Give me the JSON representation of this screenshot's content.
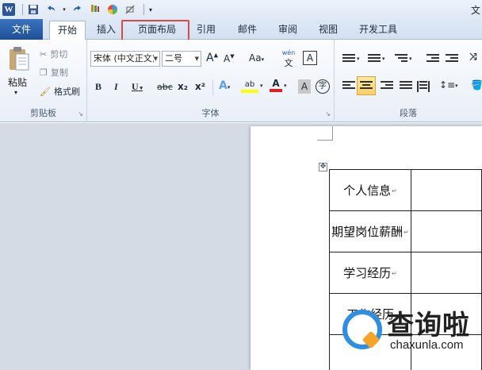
{
  "quick_access": {
    "app_letter": "W",
    "title_edge": "文"
  },
  "tabs": {
    "file": "文件",
    "home": "开始",
    "insert": "插入",
    "page_layout": "页面布局",
    "references": "引用",
    "mailings": "邮件",
    "review": "审阅",
    "view": "视图",
    "developer": "开发工具"
  },
  "clipboard": {
    "paste": "粘贴",
    "cut": "剪切",
    "copy": "复制",
    "format_painter": "格式刷",
    "group_label": "剪贴板"
  },
  "font": {
    "font_name": "宋体 (中文正文)",
    "font_size": "二号",
    "grow": "A",
    "shrink": "A",
    "change_case": "Aa",
    "phonetic": "wén",
    "char_border": "A",
    "bold": "B",
    "italic": "I",
    "underline": "U",
    "strikethrough": "abc",
    "subscript": "x₂",
    "superscript": "x²",
    "text_effects": "A",
    "highlight": "ab",
    "font_color": "A",
    "char_shading": "A",
    "enclose": "字",
    "group_label": "字体"
  },
  "paragraph": {
    "group_label": "段落"
  },
  "document": {
    "rows": [
      {
        "label": "个人信息",
        "value": ""
      },
      {
        "label": "期望岗位薪酬",
        "value": ""
      },
      {
        "label": "学习经历",
        "value": ""
      },
      {
        "label": "工作经历",
        "value": ""
      },
      {
        "label": "",
        "value": ""
      }
    ],
    "para_mark": "↵"
  },
  "watermark": {
    "text": "查询啦",
    "url": "chaxunla.com"
  },
  "colors": {
    "file_tab": "#2b5ea8",
    "highlight_box": "#d84a4a",
    "font_color_bar": "#e02020",
    "highlight_bar": "#ffff00",
    "watermark_blue": "#2f8fe0",
    "watermark_orange": "#f6a52a"
  }
}
